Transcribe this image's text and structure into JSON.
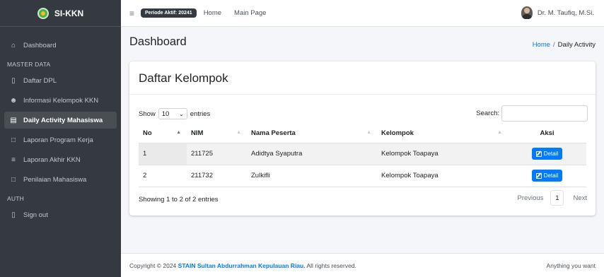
{
  "brand": {
    "name": "SI-KKN"
  },
  "sidebar": {
    "items": [
      {
        "label": "Dashboard",
        "icon": "home-icon",
        "active": false
      },
      {
        "label": "Daftar DPL",
        "icon": "list-icon",
        "active": false
      },
      {
        "label": "Informasi Kelompok KKN",
        "icon": "users-icon",
        "active": false
      },
      {
        "label": "Daily Activity Mahasiswa",
        "icon": "calendar-icon",
        "active": true
      },
      {
        "label": "Laporan Program Kerja",
        "icon": "file-icon",
        "active": false
      },
      {
        "label": "Laporan Akhir KKN",
        "icon": "tasks-icon",
        "active": false
      },
      {
        "label": "Penilaian Mahasiswa",
        "icon": "file-alt-icon",
        "active": false
      },
      {
        "label": "Sign out",
        "icon": "sign-out-icon",
        "active": false
      }
    ],
    "headers": {
      "master": "MASTER DATA",
      "auth": "AUTH"
    }
  },
  "topbar": {
    "periode_badge": "Periode Aktif: 20241",
    "home_link": "Home",
    "main_link": "Main Page",
    "user_name": "Dr. M. Taufiq, M.Si."
  },
  "content": {
    "title": "Dashboard",
    "breadcrumb": {
      "home": "Home",
      "separator": "/",
      "current": "Daily Activity"
    }
  },
  "card": {
    "title": "Daftar Kelompok",
    "show_label": "Show",
    "entries_value": "10",
    "entries_label": "entries",
    "search_label": "Search:",
    "columns": [
      "No",
      "NIM",
      "Nama Peserta",
      "Kelompok",
      "Aksi"
    ],
    "rows": [
      {
        "no": "1",
        "nim": "211725",
        "nama": "Adidtya Syaputra",
        "kelompok": "Kelompok Toapaya",
        "aksi": "Detail"
      },
      {
        "no": "2",
        "nim": "211732",
        "nama": "Zulkifli",
        "kelompok": "Kelompok Toapaya",
        "aksi": "Detail"
      }
    ],
    "info": "Showing 1 to 2 of 2 entries",
    "pagination": {
      "previous": "Previous",
      "page": "1",
      "next": "Next"
    }
  },
  "footer": {
    "copyright_prefix": "Copyright © 2024",
    "institution": "STAIN Sultan Abdurrahman Kepulauan Riau.",
    "rights": "All rights reserved.",
    "right_text": "Anything you want"
  },
  "colors": {
    "sidebar_bg": "#343a40",
    "accent": "#007bff",
    "content_bg": "#f4f6f9"
  }
}
